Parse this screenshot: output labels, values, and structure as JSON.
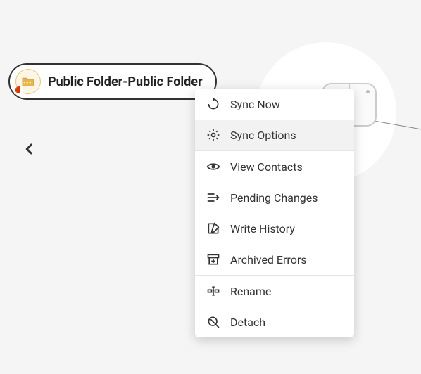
{
  "folder": {
    "label": "Public Folder-Public Folder"
  },
  "menu": {
    "items": [
      {
        "label": "Sync Now"
      },
      {
        "label": "Sync Options"
      },
      {
        "label": "View Contacts"
      },
      {
        "label": "Pending Changes"
      },
      {
        "label": "Write History"
      },
      {
        "label": "Archived Errors"
      },
      {
        "label": "Rename"
      },
      {
        "label": "Detach"
      }
    ]
  }
}
